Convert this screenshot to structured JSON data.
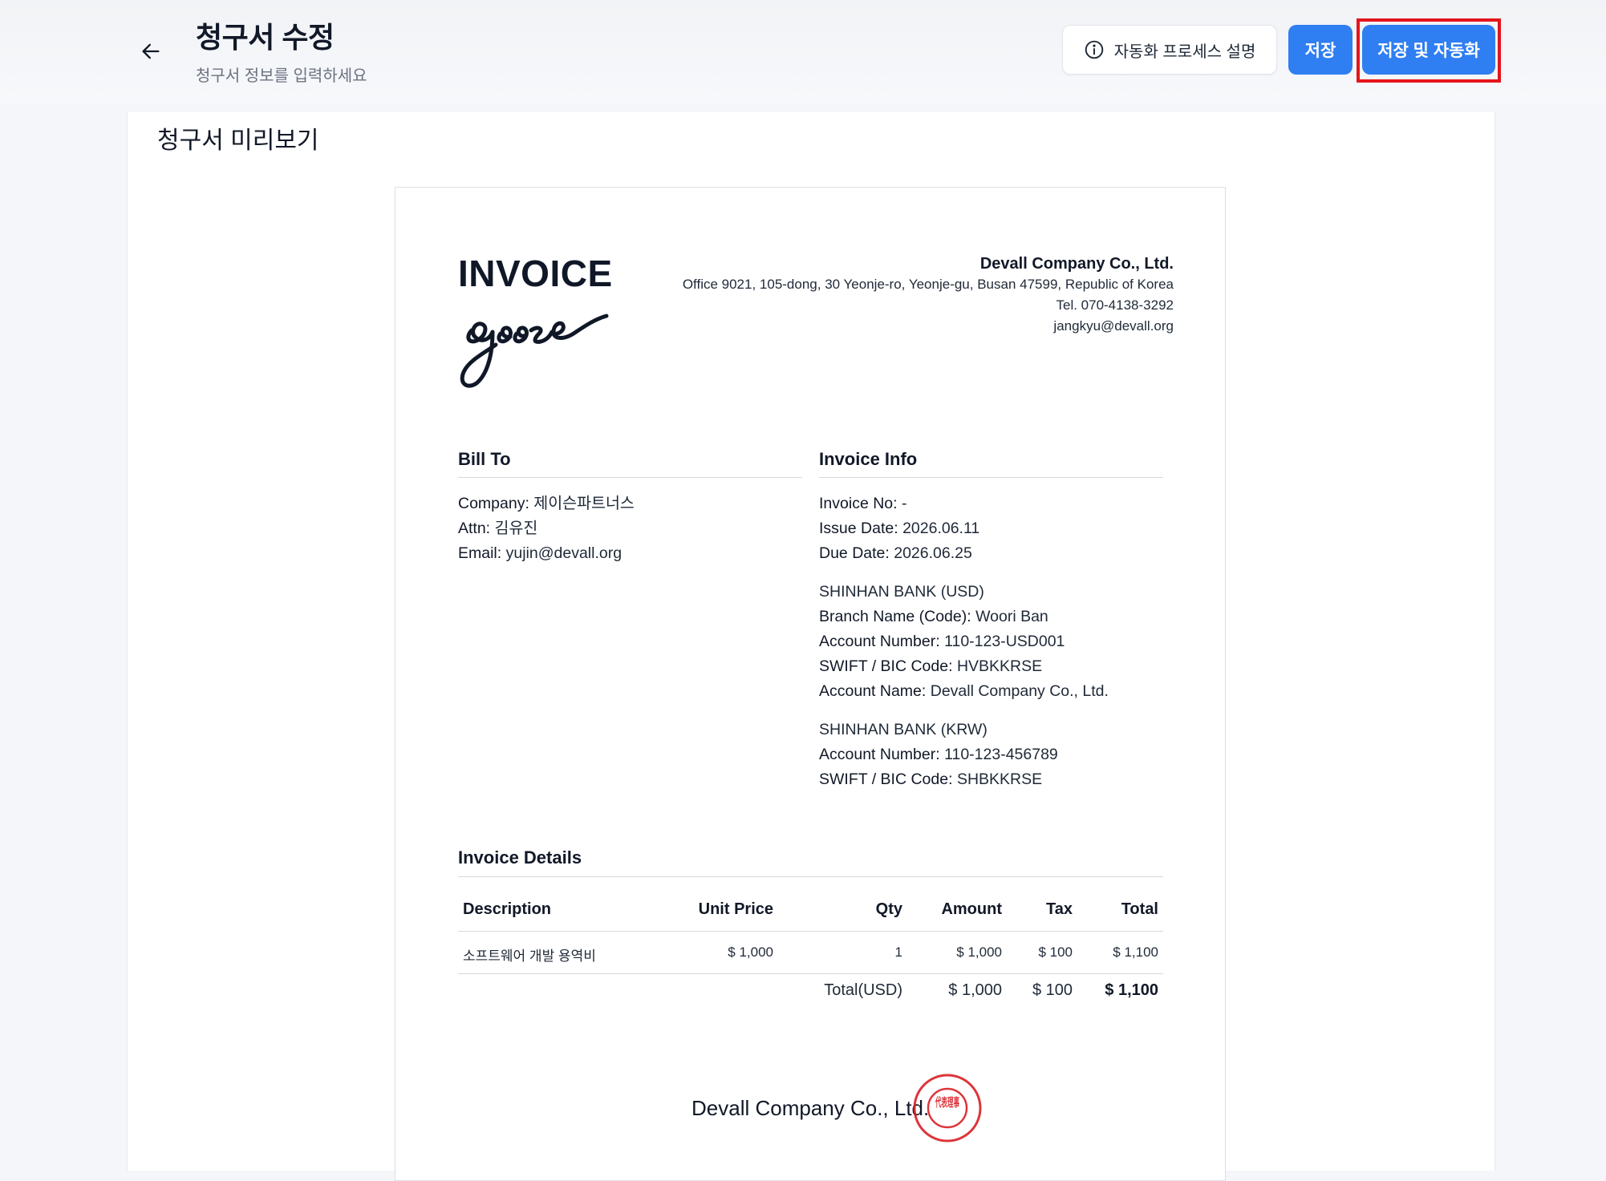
{
  "header": {
    "title": "청구서 수정",
    "subtitle": "청구서 정보를 입력하세요",
    "help_label": "자동화 프로세스 설명",
    "save_label": "저장",
    "save_auto_label": "저장 및 자동화",
    "icons": {
      "back": "arrow-left-icon",
      "help": "info-circle-icon"
    }
  },
  "preview": {
    "title": "청구서 미리보기",
    "invoice_heading": "INVOICE",
    "logo_text": "goose",
    "company": {
      "name": "Devall Company Co., Ltd.",
      "address": "Office 9021, 105-dong, 30 Yeonje-ro, Yeonje-gu, Busan 47599, Republic of Korea",
      "tel": "Tel. 070-4138-3292",
      "email": "jangkyu@devall.org"
    },
    "bill_to": {
      "title": "Bill To",
      "company_label": "Company:",
      "company": "제이슨파트너스",
      "attn_label": "Attn:",
      "attn": "김유진",
      "email_label": "Email:",
      "email": "yujin@devall.org"
    },
    "invoice_info": {
      "title": "Invoice Info",
      "no_label": "Invoice No:",
      "no": "-",
      "issue_label": "Issue Date:",
      "issue": "2026.06.11",
      "due_label": "Due Date:",
      "due": "2026.06.25",
      "bank_usd": {
        "title": "SHINHAN BANK (USD)",
        "branch_label": "Branch Name (Code):",
        "branch": "Woori Ban",
        "account_label": "Account Number:",
        "account": "110-123-USD001",
        "swift_label": "SWIFT / BIC Code:",
        "swift": "HVBKKRSE",
        "name_label": "Account Name:",
        "name": "Devall Company Co., Ltd."
      },
      "bank_krw": {
        "title": "SHINHAN BANK (KRW)",
        "account_label": "Account Number:",
        "account": "110-123-456789",
        "swift_label": "SWIFT / BIC Code:",
        "swift": "SHBKKRSE"
      }
    },
    "details": {
      "title": "Invoice Details",
      "columns": {
        "description": "Description",
        "unit_price": "Unit Price",
        "qty": "Qty",
        "amount": "Amount",
        "tax": "Tax",
        "total": "Total"
      },
      "rows": [
        {
          "description": "소프트웨어 개발 용역비",
          "unit_price": "$ 1,000",
          "qty": "1",
          "amount": "$ 1,000",
          "tax": "$ 100",
          "total": "$ 1,100"
        }
      ],
      "totals": {
        "label": "Total(USD)",
        "amount": "$ 1,000",
        "tax": "$ 100",
        "total": "$ 1,100"
      }
    },
    "signature": {
      "company": "Devall Company Co., Ltd.",
      "seal_text": "代表理事"
    }
  }
}
